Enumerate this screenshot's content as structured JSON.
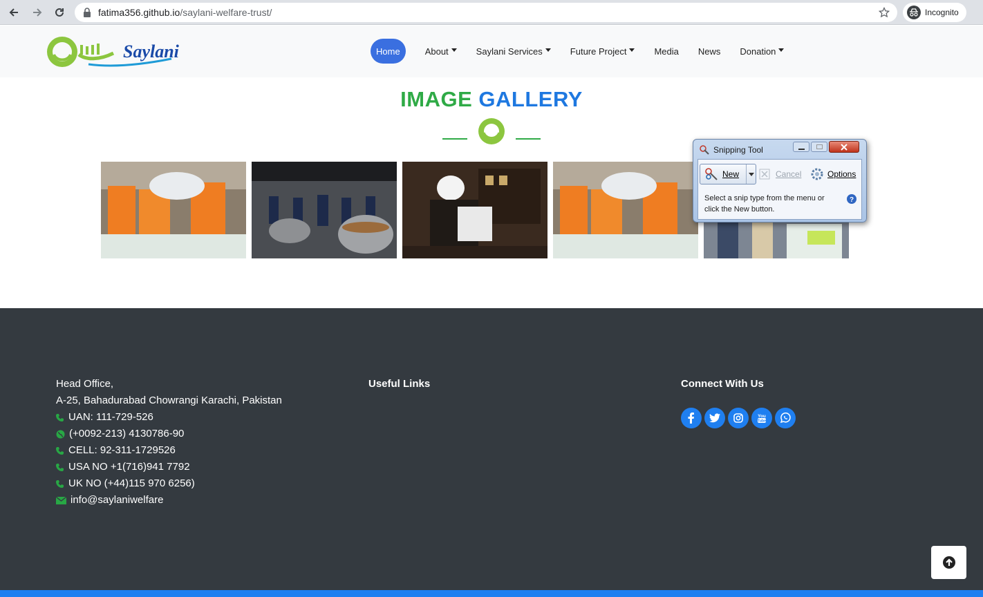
{
  "browser": {
    "url_host": "fatima356.github.io",
    "url_path": "/saylani-welfare-trust/",
    "incognito_label": "Incognito"
  },
  "header": {
    "logo_alt": "Saylani",
    "nav": [
      {
        "label": "Home",
        "active": true,
        "dropdown": false
      },
      {
        "label": "About",
        "active": false,
        "dropdown": true
      },
      {
        "label": "Saylani Services",
        "active": false,
        "dropdown": true
      },
      {
        "label": "Future Project",
        "active": false,
        "dropdown": true
      },
      {
        "label": "Media",
        "active": false,
        "dropdown": false
      },
      {
        "label": "News",
        "active": false,
        "dropdown": false
      },
      {
        "label": "Donation",
        "active": false,
        "dropdown": true
      }
    ]
  },
  "gallery": {
    "title_part1": "IMAGE",
    "title_part2": "GALLERY",
    "images": [
      "volunteers-carrying-sacks",
      "kitchen-cooking",
      "scholar-at-desk",
      "volunteers-carrying-sacks",
      "distribution-crowd"
    ]
  },
  "snipping_tool": {
    "title": "Snipping Tool",
    "new_label": "New",
    "cancel_label": "Cancel",
    "options_label": "Options",
    "message": "Select a snip type from the menu or click the New button."
  },
  "footer": {
    "address": {
      "line1": "Head Office,",
      "line2": "A-25, Bahadurabad Chowrangi Karachi, Pakistan",
      "uan": "UAN: 111-729-526",
      "phone": "(+0092-213) 4130786-90",
      "cell": "CELL: 92-311-1729526",
      "usa": "USA NO +1(716)941 7792",
      "uk": "UK NO (+44)115 970 6256)",
      "email": "info@saylaniwelfare"
    },
    "useful_links_heading": "Useful Links",
    "connect_heading": "Connect With Us",
    "social_icons": [
      "facebook-icon",
      "twitter-icon",
      "instagram-icon",
      "youtube-icon",
      "whatsapp-icon"
    ]
  },
  "colors": {
    "green": "#2faa46",
    "blue": "#1e78e0",
    "footer_bg": "#343a40",
    "nav_active": "#3a6fe0"
  }
}
